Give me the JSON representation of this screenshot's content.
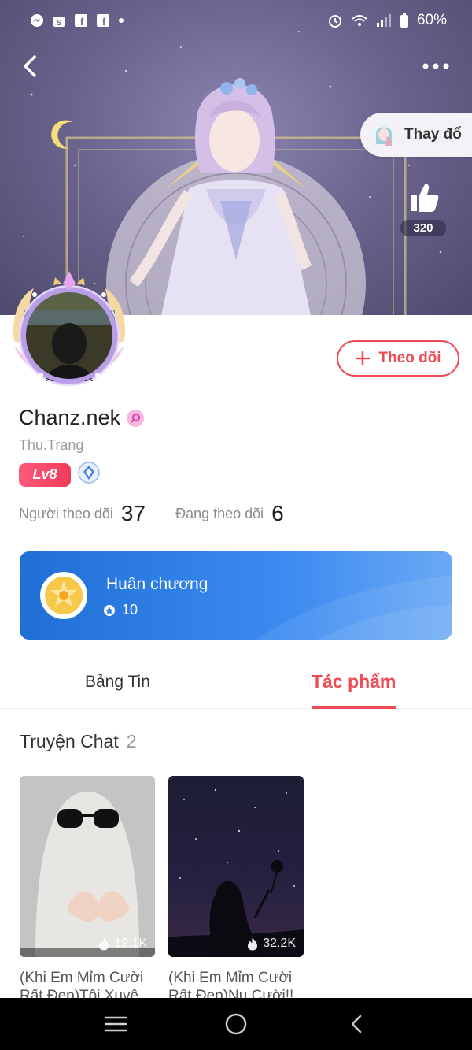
{
  "status_bar": {
    "battery": "60%",
    "left_icons": [
      "messenger-icon",
      "shop-icon",
      "facebook-icon",
      "facebook-icon",
      "dot-icon"
    ],
    "right_icons": [
      "alarm-icon",
      "wifi-icon",
      "signal-icon",
      "battery-icon"
    ]
  },
  "header": {
    "change_label": "Thay đổ",
    "like_count": "320"
  },
  "profile": {
    "username": "Chanz.nek",
    "nickname": "Thu.Trang",
    "level": "Lv8",
    "follow_label": "Theo dõi",
    "followers_label": "Người theo dõi",
    "followers_count": "37",
    "following_label": "Đang theo dõi",
    "following_count": "6"
  },
  "medal": {
    "title": "Huân chương",
    "count": "10"
  },
  "tabs": {
    "feed": "Bảng Tin",
    "works": "Tác phẩm",
    "active": "works"
  },
  "section": {
    "title": "Truyện Chat",
    "count": "2"
  },
  "stories": [
    {
      "views": "19.1K",
      "title": "(Khi Em Mỉm Cười Rất Đẹp)Tôi Xuyê..."
    },
    {
      "views": "32.2K",
      "title": "(Khi Em Mỉm Cười Rất Đẹp)Nụ Cười!!"
    }
  ],
  "colors": {
    "accent": "#ee4b54",
    "medal_blue": "#1f6fd6",
    "level_pink": "#ef3b59"
  }
}
